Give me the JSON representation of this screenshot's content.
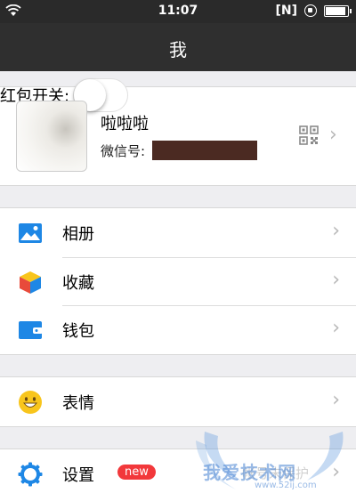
{
  "status_bar": {
    "time": "11:07",
    "n_indicator": "[N]"
  },
  "nav": {
    "title": "我"
  },
  "profile": {
    "redpacket_label": "红包开关:",
    "name": "啦啦啦",
    "wechat_id_label": "微信号:"
  },
  "menu": {
    "album": "相册",
    "favorites": "收藏",
    "wallet": "钱包",
    "stickers": "表情",
    "settings": "设置",
    "settings_badge": "new"
  },
  "watermark": {
    "text": "我爱技术网",
    "url": "www.52ij.com",
    "sub_text": "帐号未保护"
  },
  "colors": {
    "navbar": "#2f2f2f",
    "badge": "#f2383b",
    "icon_blue": "#1e87e5",
    "smile_yellow": "#f8c51c"
  }
}
